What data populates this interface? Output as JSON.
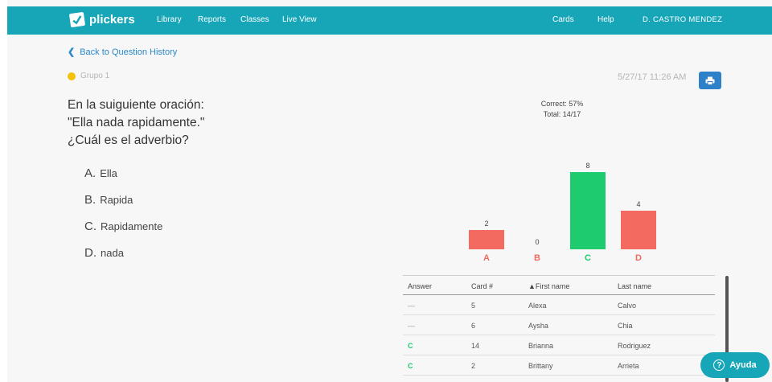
{
  "nav": {
    "logo_text": "plickers",
    "links": [
      "Library",
      "Reports",
      "Classes",
      "Live View"
    ],
    "right_links": [
      "Cards",
      "Help"
    ],
    "user": "D. CASTRO MENDEZ"
  },
  "back_link": "Back to Question History",
  "group": {
    "name": "Grupo 1",
    "color": "#f4c20d"
  },
  "timestamp": "5/27/17 11:26 AM",
  "question": {
    "line1": "En la suiguiente oración:",
    "line2": "\"Ella nada rapidamente.\"",
    "line3": "¿Cuál es el adverbio?"
  },
  "choices": [
    {
      "letter": "A.",
      "text": "Ella"
    },
    {
      "letter": "B.",
      "text": "Rapida"
    },
    {
      "letter": "C.",
      "text": "Rapidamente"
    },
    {
      "letter": "D.",
      "text": "nada"
    }
  ],
  "stats": {
    "correct": "Correct: 57%",
    "total": "Total: 14/17"
  },
  "chart_data": {
    "type": "bar",
    "categories": [
      "A",
      "B",
      "C",
      "D"
    ],
    "values": [
      2,
      0,
      8,
      4
    ],
    "correct_index": 2,
    "colors": {
      "incorrect": "#f26a60",
      "correct": "#1ecb6e"
    }
  },
  "table": {
    "headers": [
      "Answer",
      "Card #",
      "▲First name",
      "Last name"
    ],
    "rows": [
      {
        "answer": "—",
        "card": "5",
        "first": "Alexa",
        "last": "Calvo"
      },
      {
        "answer": "—",
        "card": "6",
        "first": "Aysha",
        "last": "Chia"
      },
      {
        "answer": "C",
        "card": "14",
        "first": "Brianna",
        "last": "Rodriguez"
      },
      {
        "answer": "C",
        "card": "2",
        "first": "Brittany",
        "last": "Arrieta"
      }
    ]
  },
  "help_button": {
    "label": "Ayuda",
    "icon": "?"
  }
}
